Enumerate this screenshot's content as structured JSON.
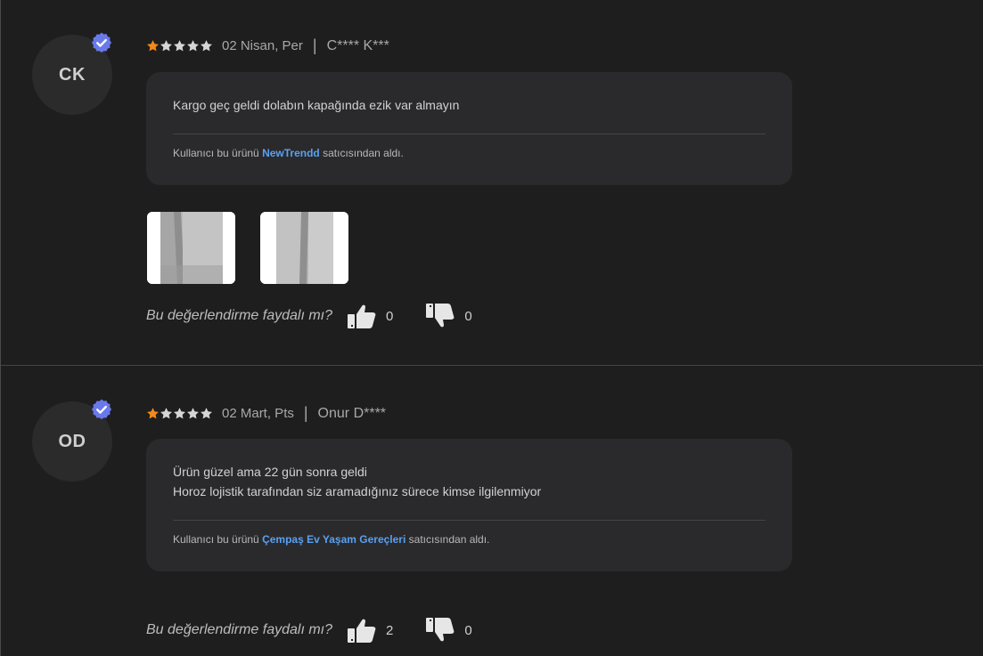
{
  "reviews": [
    {
      "initials": "CK",
      "rating": 1,
      "rating_max": 5,
      "date": "02 Nisan, Per",
      "separator": "|",
      "author": "C**** K***",
      "comment_lines": [
        "Kargo geç geldi dolabın kapağında ezik var almayın"
      ],
      "seller_prefix": "Kullanıcı bu ürünü",
      "seller_name": "NewTrendd",
      "seller_suffix": "satıcısından aldı.",
      "photos": [
        "photo-1",
        "photo-2"
      ],
      "helpful_question": "Bu değerlendirme faydalı mı?",
      "likes": "0",
      "dislikes": "0"
    },
    {
      "initials": "OD",
      "rating": 1,
      "rating_max": 5,
      "date": "02 Mart, Pts",
      "separator": "|",
      "author": "Onur D****",
      "comment_lines": [
        "Ürün güzel ama 22 gün sonra geldi",
        "Horoz lojistik tarafından siz aramadığınız sürece kimse ilgilenmiyor"
      ],
      "seller_prefix": "Kullanıcı bu ürünü",
      "seller_name": "Çempaş Ev Yaşam Gereçleri",
      "seller_suffix": "satıcısından aldı.",
      "photos": [],
      "helpful_question": "Bu değerlendirme faydalı mı?",
      "likes": "2",
      "dislikes": "0"
    }
  ],
  "colors": {
    "background": "#1e1e1f",
    "card": "#2a2a2c",
    "star_filled": "#f28a1a",
    "star_empty": "#d6d6d6",
    "verified_badge": "#6a79ea",
    "seller_link": "#5aa0f2"
  },
  "icons": {
    "verified": "verified-badge-icon",
    "star": "star-icon",
    "thumbs_up": "thumbs-up-icon",
    "thumbs_down": "thumbs-down-icon"
  }
}
